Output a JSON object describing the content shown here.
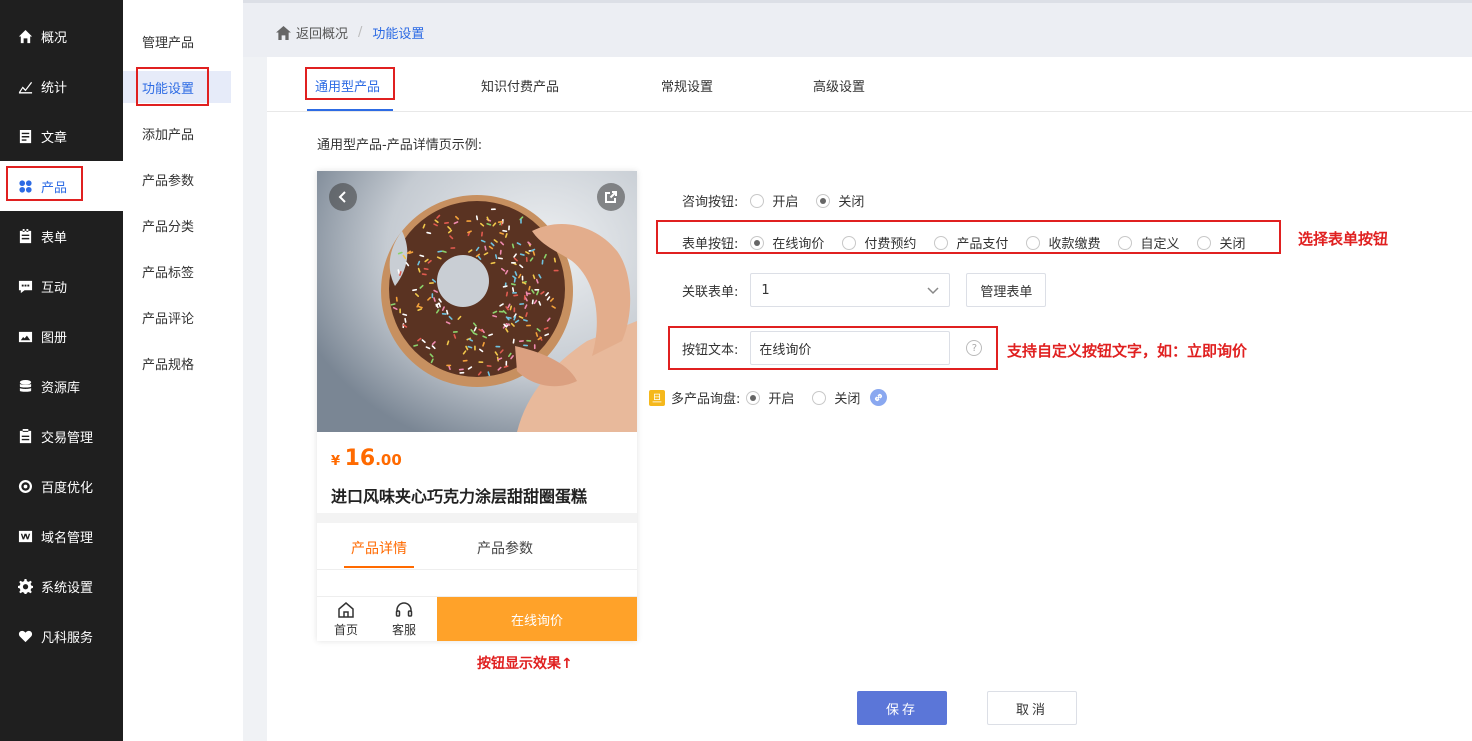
{
  "sidebar": {
    "items": [
      {
        "label": "概况",
        "icon": "home-icon"
      },
      {
        "label": "统计",
        "icon": "chart-icon"
      },
      {
        "label": "文章",
        "icon": "article-icon"
      },
      {
        "label": "产品",
        "icon": "product-icon"
      },
      {
        "label": "表单",
        "icon": "form-icon"
      },
      {
        "label": "互动",
        "icon": "chat-icon"
      },
      {
        "label": "图册",
        "icon": "gallery-icon"
      },
      {
        "label": "资源库",
        "icon": "database-icon"
      },
      {
        "label": "交易管理",
        "icon": "trade-icon"
      },
      {
        "label": "百度优化",
        "icon": "seo-icon"
      },
      {
        "label": "域名管理",
        "icon": "domain-icon"
      },
      {
        "label": "系统设置",
        "icon": "gear-icon"
      },
      {
        "label": "凡科服务",
        "icon": "heart-icon"
      }
    ]
  },
  "subnav": {
    "items": [
      "管理产品",
      "功能设置",
      "添加产品",
      "产品参数",
      "产品分类",
      "产品标签",
      "产品评论",
      "产品规格"
    ]
  },
  "breadcrumb": {
    "back": "返回概况",
    "separator": "/",
    "current": "功能设置"
  },
  "tabs": [
    "通用型产品",
    "知识付费产品",
    "常规设置",
    "高级设置"
  ],
  "demo": {
    "title": "通用型产品-产品详情页示例:",
    "price_currency": "¥",
    "price_int": "16",
    "price_dec": ".00",
    "product_name": "进口风味夹心巧克力涂层甜甜圈蛋糕",
    "tabs": [
      "产品详情",
      "产品参数"
    ],
    "bottom_home": "首页",
    "bottom_service": "客服",
    "bottom_button": "在线询价",
    "note": "按钮显示效果↑"
  },
  "form": {
    "consult_label": "咨询按钮:",
    "consult_options": [
      "开启",
      "关闭"
    ],
    "form_button_label": "表单按钮:",
    "form_button_options": [
      "在线询价",
      "付费预约",
      "产品支付",
      "收款缴费",
      "自定义",
      "关闭"
    ],
    "form_button_note": "选择表单按钮",
    "linked_form_label": "关联表单:",
    "linked_form_value": "1",
    "manage_form_button": "管理表单",
    "button_text_label": "按钮文本:",
    "button_text_value": "在线询价",
    "button_text_note": "支持自定义按钮文字，如：立即询价",
    "help": "?",
    "vip_badge": "旦",
    "multi_inquiry_label": "多产品询盘:",
    "multi_inquiry_options": [
      "开启",
      "关闭"
    ],
    "save": "保存",
    "cancel": "取消"
  }
}
